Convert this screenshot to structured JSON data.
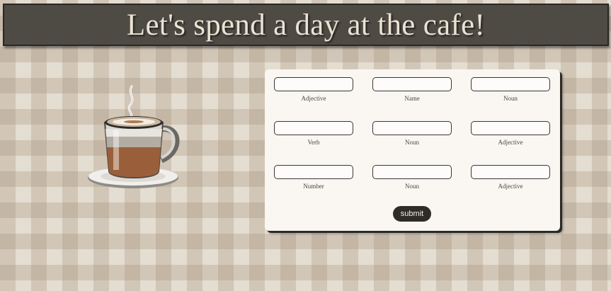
{
  "header": {
    "title": "Let's spend a day at the cafe!"
  },
  "illustration": {
    "icon": "coffee-cup-icon"
  },
  "form": {
    "fields": [
      {
        "label": "Adjective",
        "value": ""
      },
      {
        "label": "Name",
        "value": ""
      },
      {
        "label": "Noun",
        "value": ""
      },
      {
        "label": "Verb",
        "value": ""
      },
      {
        "label": "Noun",
        "value": ""
      },
      {
        "label": "Adjective",
        "value": ""
      },
      {
        "label": "Number",
        "value": ""
      },
      {
        "label": "Noun",
        "value": ""
      },
      {
        "label": "Adjective",
        "value": ""
      }
    ],
    "submit_label": "submit"
  },
  "colors": {
    "header_bg": "#4e4a44",
    "header_text": "#eae2d3",
    "card_bg": "#faf7f2",
    "button_bg": "#2f2b28",
    "checker_tint": "#c8b9a4"
  }
}
